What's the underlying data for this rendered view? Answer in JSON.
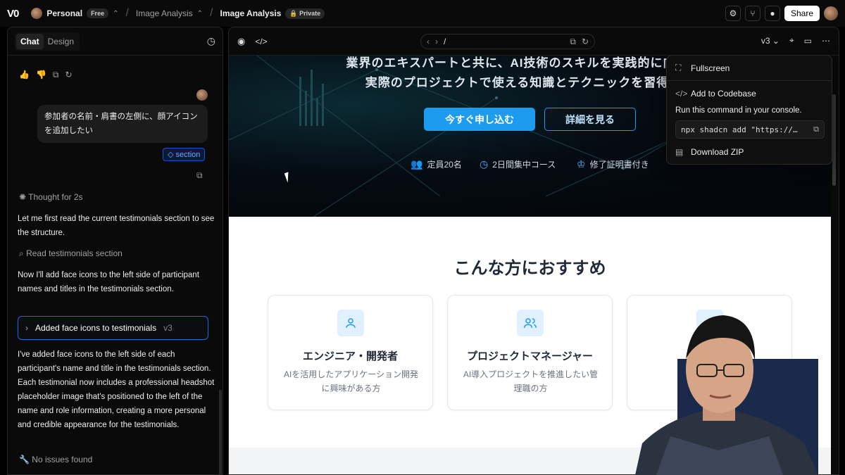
{
  "topbar": {
    "logo": "V0",
    "workspace": "Personal",
    "plan_badge": "Free",
    "project": "Image Analysis",
    "chat_title": "Image Analysis",
    "visibility": "Private",
    "share_label": "Share"
  },
  "left": {
    "tabs": [
      "Chat",
      "Design"
    ],
    "user_message": "参加者の名前・肩書の左側に、顔アイコンを追加したい",
    "context_chip": "section",
    "thought": "Thought for 2s",
    "para1": "Let me first read the current testimonials section to see the structure.",
    "tool_read": "Read testimonials section",
    "para2": "Now I'll add face icons to the left side of participant names and titles in the testimonials section.",
    "version_title": "Added face icons to testimonials",
    "version_tag": "v3",
    "para3": "I've added face icons to the left side of each participant's name and title in the testimonials section. Each testimonial now includes a professional headshot placeholder image that's positioned to the left of the name and role information, creating a more personal and credible appearance for the testimonials.",
    "tool_issues": "No issues found"
  },
  "right": {
    "url_path": "/",
    "version": "v3",
    "hero": {
      "line1": "業界のエキスパートと共に、AI技術のスキルを実践的に向上させ",
      "line2": "実際のプロジェクトで使える知識とテクニックを習得でき",
      "cta_primary": "今すぐ申し込む",
      "cta_secondary": "詳細を見る",
      "features": [
        "定員20名",
        "2日間集中コース",
        "修了証明書付き"
      ]
    },
    "section_title": "こんな方におすすめ",
    "cards": [
      {
        "title": "エンジニア・開発者",
        "desc": "AIを活用したアプリケーション開発に興味がある方"
      },
      {
        "title": "プロジェクトマネージャー",
        "desc": "AI導入プロジェクトを推進したい管理職の方"
      },
      {
        "title": "キャリ",
        "desc": "AI分野での す"
      }
    ]
  },
  "menu": {
    "fullscreen": "Fullscreen",
    "add_codebase": "Add to Codebase",
    "cmd_hint": "Run this command in your console.",
    "cmd": "npx shadcn add \"https://…",
    "download": "Download ZIP"
  },
  "colors": {
    "accent": "#1d9bf0",
    "selected_border": "#2563eb"
  }
}
